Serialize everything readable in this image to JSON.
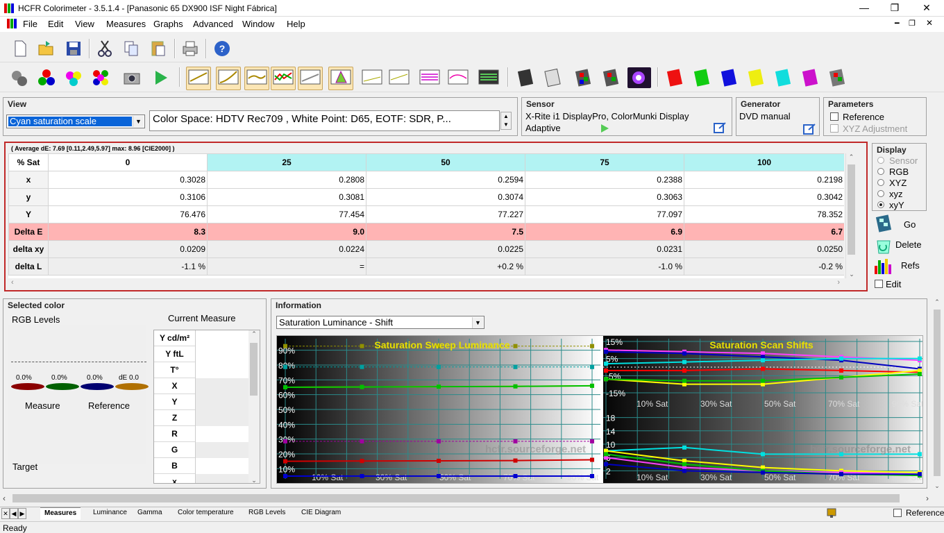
{
  "window": {
    "title": "HCFR Colorimeter - 3.5.1.4 - [Panasonic 65 DX900 ISF Night Fábrica]"
  },
  "menu": [
    "File",
    "Edit",
    "View",
    "Measures",
    "Graphs",
    "Advanced",
    "Window",
    "Help"
  ],
  "view_panel": {
    "title": "View",
    "selected": "Cyan saturation scale",
    "colorspace_text": "Color Space: HDTV Rec709 , White Point: D65, EOTF:  SDR, P..."
  },
  "sensor_panel": {
    "title": "Sensor",
    "device": "X-Rite i1 DisplayPro, ColorMunki Display",
    "mode": "Adaptive"
  },
  "generator_panel": {
    "title": "Generator",
    "value": "DVD manual"
  },
  "parameters_panel": {
    "title": "Parameters",
    "reference_label": "Reference",
    "xyz_label": "XYZ Adjustment"
  },
  "measures": {
    "summary": "( Average dE: 7.69 [0.11,2.49,5.97] max: 8.96 [CIE2000] )",
    "corner": "% Sat",
    "columns": [
      "0",
      "25",
      "50",
      "75",
      "100"
    ],
    "rows": [
      {
        "label": "x",
        "values": [
          "0.3028",
          "0.2808",
          "0.2594",
          "0.2388",
          "0.2198"
        ]
      },
      {
        "label": "y",
        "values": [
          "0.3106",
          "0.3081",
          "0.3074",
          "0.3063",
          "0.3042"
        ]
      },
      {
        "label": "Y",
        "values": [
          "76.476",
          "77.454",
          "77.227",
          "77.097",
          "78.352"
        ]
      },
      {
        "label": "Delta E",
        "values": [
          "8.3",
          "9.0",
          "7.5",
          "6.9",
          "6.7"
        ]
      },
      {
        "label": "delta xy",
        "values": [
          "0.0209",
          "0.0224",
          "0.0225",
          "0.0231",
          "0.0250"
        ]
      },
      {
        "label": "delta L",
        "values": [
          "-1.1 %",
          "=",
          "+0.2 %",
          "-1.0 %",
          "-0.2 %"
        ]
      }
    ]
  },
  "display_panel": {
    "title": "Display",
    "options": [
      "Sensor",
      "RGB",
      "XYZ",
      "xyz",
      "xyY"
    ],
    "selected": "xyY",
    "go": "Go",
    "delete": "Delete",
    "refs": "Refs",
    "edit": "Edit"
  },
  "selected_color": {
    "title": "Selected color",
    "rgb_levels": "RGB Levels",
    "current_measure": "Current Measure",
    "dots": [
      "0.0%",
      "0.0%",
      "0.0%",
      "dE 0.0"
    ],
    "measure_label": "Measure",
    "reference_label": "Reference",
    "target_label": "Target",
    "table_rows": [
      "Y cd/m²",
      "Y ftL",
      "T°",
      "X",
      "Y",
      "Z",
      "R",
      "G",
      "B",
      "x"
    ]
  },
  "information": {
    "title": "Information",
    "selected": "Saturation Luminance - Shift",
    "watermark": "hcfr.sourceforge.net",
    "left_chart_title": "Saturation Sweep Luminance",
    "right_chart_title": "Saturation Scan Shifts",
    "left_y_ticks": [
      "90%",
      "80%",
      "70%",
      "60%",
      "50%",
      "40%",
      "30%",
      "20%",
      "10%"
    ],
    "x_ticks": [
      "10% Sat",
      "30% Sat",
      "50% Sat",
      "70% Sat",
      "90% Sat"
    ],
    "right_top_ticks": [
      "15%",
      "5%",
      "-5%",
      "-15%"
    ],
    "right_bottom_ticks": [
      "18",
      "14",
      "10",
      "6",
      "2"
    ]
  },
  "chart_data": [
    {
      "type": "line",
      "title": "Saturation Sweep Luminance",
      "x": [
        0,
        25,
        50,
        75,
        100
      ],
      "ylim": [
        5,
        95
      ],
      "series": [
        {
          "color": "#f0d000",
          "values": [
            65,
            65.2,
            65.4,
            65.6,
            66
          ]
        },
        {
          "color": "#00c000",
          "values": [
            65,
            65.2,
            65.4,
            65.6,
            66
          ]
        },
        {
          "color": "#d00000",
          "values": [
            15,
            15.2,
            15.3,
            15.5,
            16
          ]
        },
        {
          "color": "#0000d0",
          "values": [
            5,
            5,
            5,
            5,
            5
          ]
        }
      ],
      "reference_series": [
        {
          "color": "#909000",
          "values": [
            92.8,
            92.8,
            92.8,
            92.8,
            92.8
          ]
        },
        {
          "color": "#00a0a0",
          "values": [
            78.7,
            78.7,
            78.7,
            78.7,
            78.7
          ]
        },
        {
          "color": "#a000a0",
          "values": [
            28.5,
            28.5,
            28.5,
            28.5,
            28.5
          ]
        }
      ]
    },
    {
      "type": "line",
      "title": "Saturation Scan Shifts",
      "x": [
        0,
        25,
        50,
        75,
        100
      ],
      "ylim": [
        -15,
        15
      ],
      "series": [
        {
          "color": "#ff40ff",
          "values": [
            10,
            9,
            8,
            6,
            4
          ]
        },
        {
          "color": "#0000c0",
          "values": [
            9,
            8,
            6,
            4,
            -1
          ]
        },
        {
          "color": "#ff0000",
          "values": [
            -2,
            -2,
            -1,
            -2,
            -3
          ]
        },
        {
          "color": "#ffff00",
          "values": [
            -7,
            -10,
            -10,
            -6,
            -2
          ]
        },
        {
          "color": "#00c000",
          "values": [
            -7,
            -8,
            -8,
            -6,
            -4
          ]
        },
        {
          "color": "#00e0e0",
          "values": [
            2,
            3,
            4,
            5,
            5
          ]
        }
      ]
    },
    {
      "type": "line",
      "title": "",
      "x": [
        0,
        25,
        50,
        75,
        100
      ],
      "ylim": [
        0,
        20
      ],
      "series": [
        {
          "color": "#00e0e0",
          "values": [
            8,
            9,
            7,
            7,
            7
          ]
        },
        {
          "color": "#ffff00",
          "values": [
            8,
            5,
            3,
            2,
            1.5
          ]
        },
        {
          "color": "#ff40ff",
          "values": [
            6,
            3,
            2,
            1.5,
            1
          ]
        },
        {
          "color": "#00c000",
          "values": [
            7,
            4,
            2,
            1,
            0.6
          ]
        },
        {
          "color": "#0000c0",
          "values": [
            4,
            2,
            1.5,
            1,
            1
          ]
        }
      ]
    }
  ],
  "tabs": [
    "Measures",
    "Luminance",
    "Gamma",
    "Color temperature",
    "RGB Levels",
    "CIE Diagram"
  ],
  "status": {
    "text": "Ready",
    "reference": "Reference"
  }
}
